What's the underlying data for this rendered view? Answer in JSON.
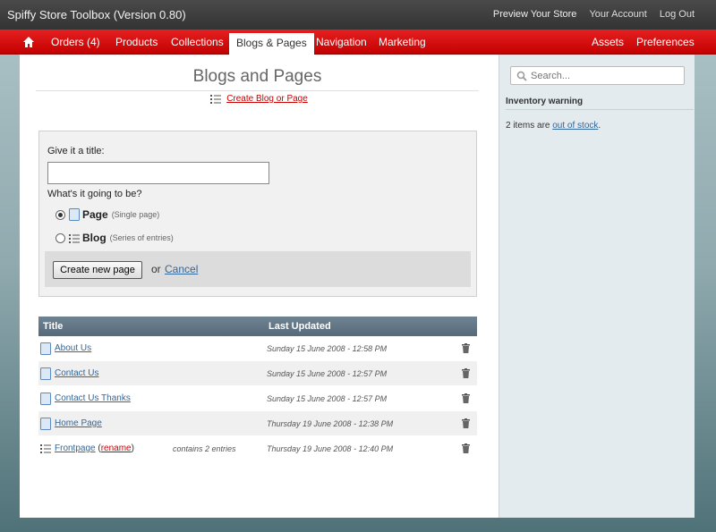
{
  "app": {
    "title": "Spiffy Store Toolbox (Version 0.80)",
    "top_links": [
      "Preview Your Store",
      "Your Account",
      "Log Out"
    ]
  },
  "nav": {
    "items": [
      "Orders (4)",
      "Products",
      "Collections",
      "Blogs & Pages",
      "Navigation",
      "Marketing"
    ],
    "right_items": [
      "Assets",
      "Preferences"
    ],
    "active": "Blogs & Pages"
  },
  "main": {
    "title": "Blogs and Pages",
    "create_link": "Create Blog or Page",
    "form": {
      "title_label": "Give it a title:",
      "title_value": "",
      "type_label": "What's it going to be?",
      "options": [
        {
          "label": "Page",
          "hint": "(Single page)",
          "checked": true
        },
        {
          "label": "Blog",
          "hint": "(Series of entries)",
          "checked": false
        }
      ],
      "submit_label": "Create new page",
      "or_text": "or",
      "cancel_label": "Cancel"
    },
    "table": {
      "headers": [
        "Title",
        "Last Updated"
      ],
      "rows": [
        {
          "title": "About Us",
          "entries": "",
          "updated": "Sunday 15 June 2008 - 12:58 PM",
          "type": "page"
        },
        {
          "title": "Contact Us",
          "entries": "",
          "updated": "Sunday 15 June 2008 - 12:57 PM",
          "type": "page"
        },
        {
          "title": "Contact Us Thanks",
          "entries": "",
          "updated": "Sunday 15 June 2008 - 12:57 PM",
          "type": "page"
        },
        {
          "title": "Home Page",
          "entries": "",
          "updated": "Thursday 19 June 2008 - 12:38 PM",
          "type": "page"
        },
        {
          "title": "Frontpage",
          "rename": "rename",
          "entries": "contains 2 entries",
          "updated": "Thursday 19 June 2008 - 12:40 PM",
          "type": "blog"
        }
      ]
    }
  },
  "sidebar": {
    "search_placeholder": "Search...",
    "inventory_heading": "Inventory warning",
    "inventory_text_prefix": "2 items are ",
    "inventory_link": "out of stock",
    "inventory_text_suffix": "."
  },
  "colors": {
    "nav_red": "#d90b0b",
    "link_blue": "#336699",
    "link_red": "#cc0000"
  }
}
